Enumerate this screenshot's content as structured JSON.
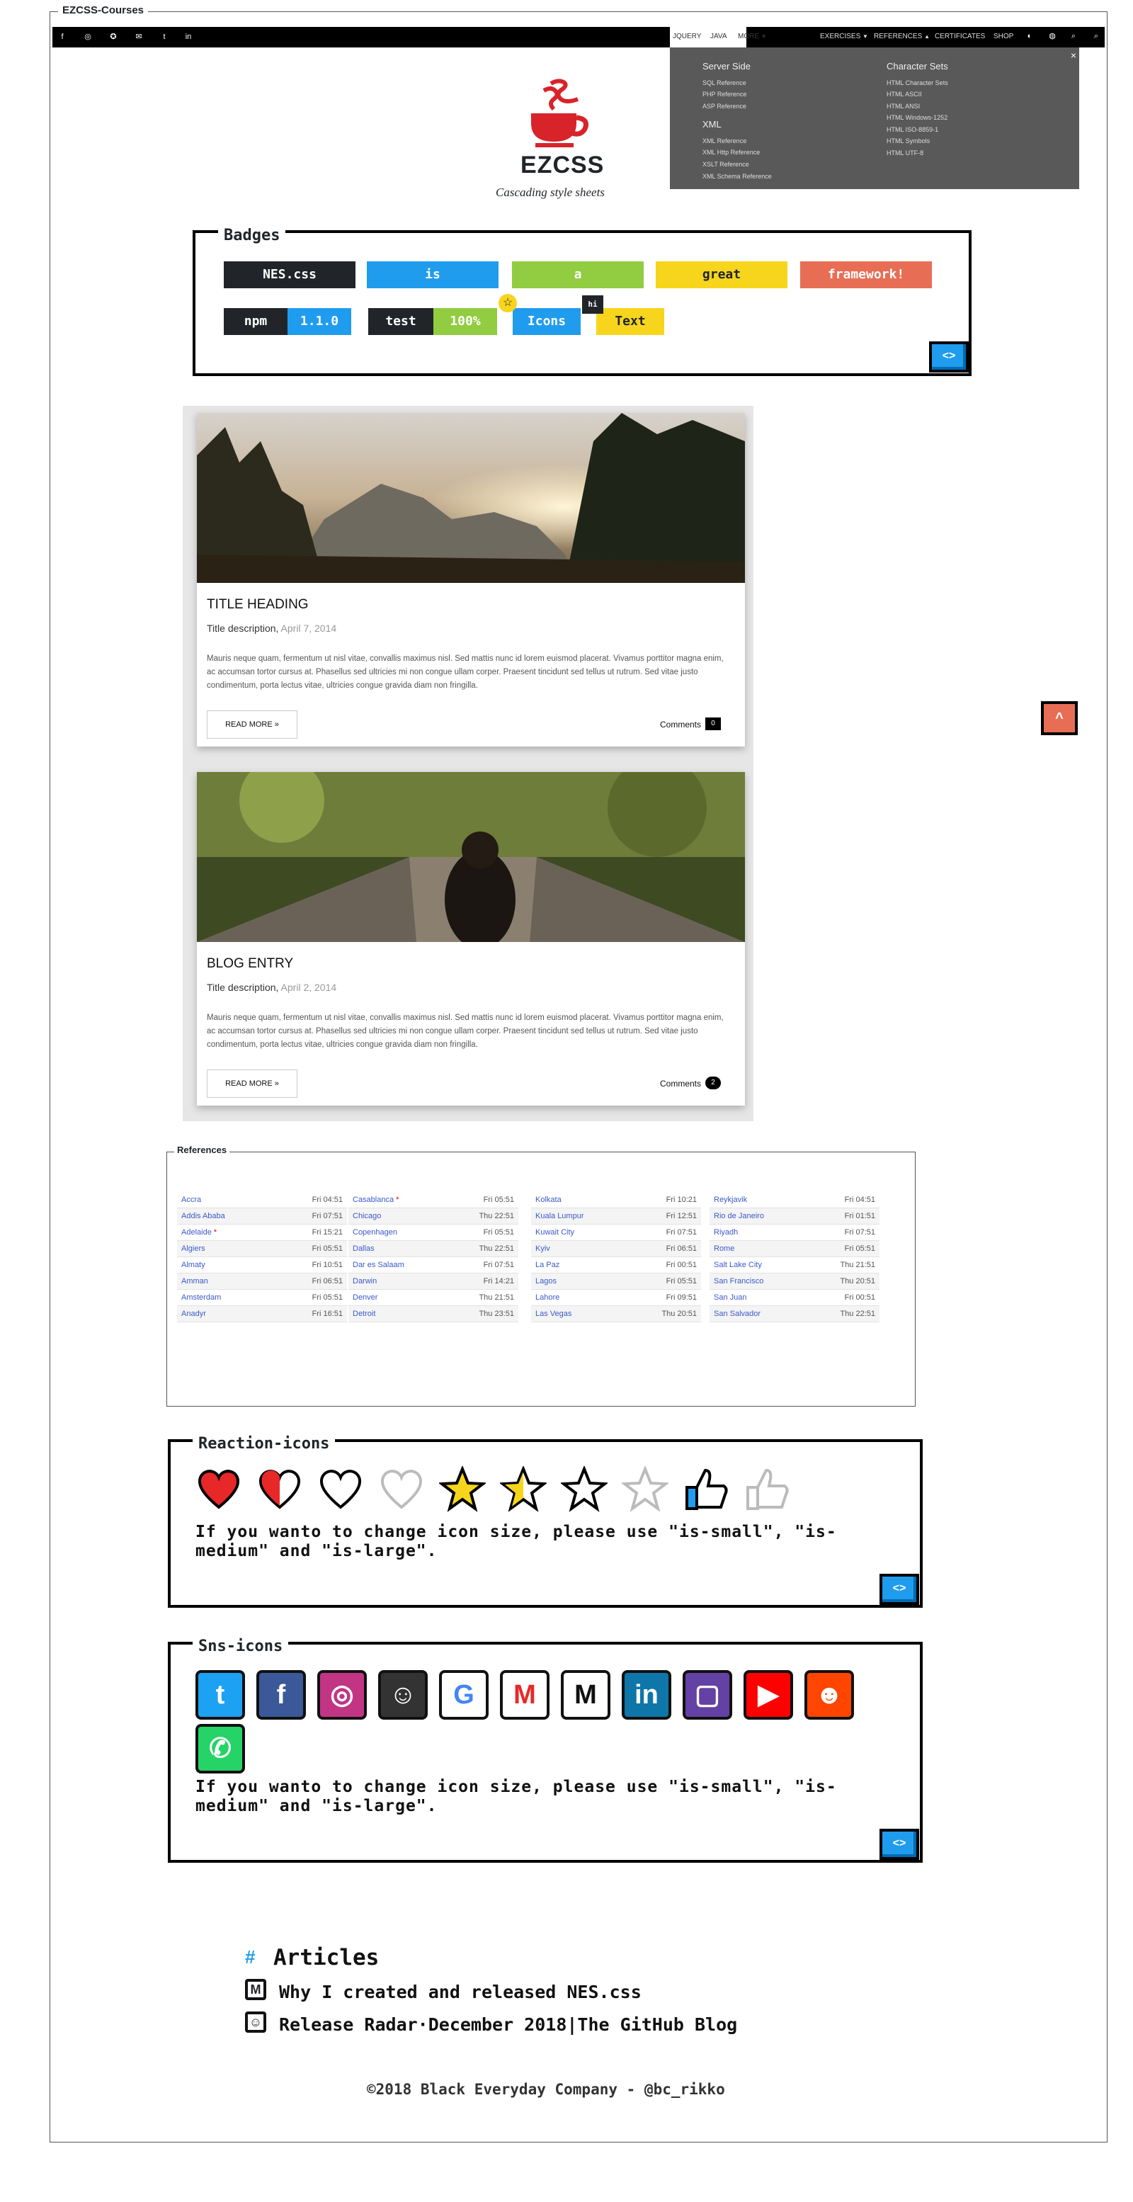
{
  "window": {
    "title": "EZCSS-Courses"
  },
  "topbar": {
    "social_icons": [
      "facebook-icon",
      "instagram-icon",
      "reddit-icon",
      "email-icon",
      "twitter-icon",
      "linkedin-icon"
    ],
    "nav_left": [
      "JQUERY",
      "JAVA",
      "MORE"
    ],
    "nav_right": [
      "EXERCISES",
      "REFERENCES",
      "CERTIFICATES",
      "SHOP"
    ],
    "right_icons": [
      "contrast-icon",
      "globe-icon",
      "search-icon",
      "search-icon"
    ]
  },
  "dropdown": {
    "close": "×",
    "col1": [
      {
        "heading": "Server Side",
        "items": [
          "SQL Reference",
          "PHP Reference",
          "ASP Reference"
        ]
      },
      {
        "heading": "XML",
        "items": [
          "XML Reference",
          "XML Http Reference",
          "XSLT Reference",
          "XML Schema Reference"
        ]
      }
    ],
    "col2": [
      {
        "heading": "Character Sets",
        "items": [
          "HTML Character Sets",
          "HTML ASCII",
          "HTML ANSI",
          "HTML Windows-1252",
          "HTML ISO-8859-1",
          "HTML Symbols",
          "HTML UTF-8"
        ]
      }
    ]
  },
  "logo": {
    "word": "EZCSS",
    "tagline": "Cascading style sheets"
  },
  "badges": {
    "title": "Badges",
    "row1": [
      "NES.css",
      "is",
      "a",
      "great",
      "framework!"
    ],
    "split": [
      {
        "left": "npm",
        "right": "1.1.0"
      },
      {
        "left": "test",
        "right": "100%"
      }
    ],
    "icon_badges": [
      {
        "label": "Icons",
        "icon": "star-icon"
      },
      {
        "label": "Text",
        "tag": "hi"
      }
    ],
    "code_button": "<>"
  },
  "colors": {
    "dark": "#212529",
    "blue": "#209cee",
    "green": "#92cc41",
    "yellow": "#f7d51d",
    "red": "#e76e55"
  },
  "cards": [
    {
      "title": "TITLE HEADING",
      "desc": "Title description,",
      "date": "April 7, 2014",
      "body": "Mauris neque quam, fermentum ut nisl vitae, convallis maximus nisl. Sed mattis nunc id lorem euismod placerat. Vivamus porttitor magna enim, ac accumsan tortor cursus at. Phasellus sed ultricies mi non congue ullam corper. Praesent tincidunt sed tellus ut rutrum. Sed vitae justo condimentum, porta lectus vitae, ultricies congue gravida diam non fringilla.",
      "button": "READ MORE »",
      "comments_label": "Comments",
      "comments_count": "0"
    },
    {
      "title": "BLOG ENTRY",
      "desc": "Title description,",
      "date": "April 2, 2014",
      "body": "Mauris neque quam, fermentum ut nisl vitae, convallis maximus nisl. Sed mattis nunc id lorem euismod placerat. Vivamus porttitor magna enim, ac accumsan tortor cursus at. Phasellus sed ultricies mi non congue ullam corper. Praesent tincidunt sed tellus ut rutrum. Sed vitae justo condimentum, porta lectus vitae, ultricies congue gravida diam non fringilla.",
      "button": "READ MORE »",
      "comments_label": "Comments",
      "comments_count": "2"
    }
  ],
  "scroll_top": "^",
  "references": {
    "legend": "References",
    "columns": [
      [
        [
          "Accra",
          "Fri 04:51"
        ],
        [
          "Addis Ababa",
          "Fri 07:51"
        ],
        [
          "Adelaide *",
          "Fri 15:21"
        ],
        [
          "Algiers",
          "Fri 05:51"
        ],
        [
          "Almaty",
          "Fri 10:51"
        ],
        [
          "Amman",
          "Fri 06:51"
        ],
        [
          "Amsterdam",
          "Fri 05:51"
        ],
        [
          "Anadyr",
          "Fri 16:51"
        ]
      ],
      [
        [
          "Casablanca *",
          "Fri 05:51"
        ],
        [
          "Chicago",
          "Thu 22:51"
        ],
        [
          "Copenhagen",
          "Fri 05:51"
        ],
        [
          "Dallas",
          "Thu 22:51"
        ],
        [
          "Dar es Salaam",
          "Fri 07:51"
        ],
        [
          "Darwin",
          "Fri 14:21"
        ],
        [
          "Denver",
          "Thu 21:51"
        ],
        [
          "Detroit",
          "Thu 23:51"
        ]
      ],
      [
        [
          "Kolkata",
          "Fri 10:21"
        ],
        [
          "Kuala Lumpur",
          "Fri 12:51"
        ],
        [
          "Kuwait City",
          "Fri 07:51"
        ],
        [
          "Kyiv",
          "Fri 06:51"
        ],
        [
          "La Paz",
          "Fri 00:51"
        ],
        [
          "Lagos",
          "Fri 05:51"
        ],
        [
          "Lahore",
          "Fri 09:51"
        ],
        [
          "Las Vegas",
          "Thu 20:51"
        ]
      ],
      [
        [
          "Reykjavik",
          "Fri 04:51"
        ],
        [
          "Rio de Janeiro",
          "Fri 01:51"
        ],
        [
          "Riyadh",
          "Fri 07:51"
        ],
        [
          "Rome",
          "Fri 05:51"
        ],
        [
          "Salt Lake City",
          "Thu 21:51"
        ],
        [
          "San Francisco",
          "Thu 20:51"
        ],
        [
          "San Juan",
          "Fri 00:51"
        ],
        [
          "San Salvador",
          "Thu 22:51"
        ]
      ]
    ]
  },
  "reactions": {
    "title": "Reaction-icons",
    "icons": [
      "heart-icon",
      "half-heart-icon",
      "empty-heart-icon",
      "transparent-heart-icon",
      "star-icon",
      "half-star-icon",
      "empty-star-icon",
      "transparent-star-icon",
      "like-icon",
      "empty-like-icon"
    ],
    "note": "If you wanto to change icon size, please use \"is-small\", \"is-medium\" and \"is-large\".",
    "code_button": "<>"
  },
  "sns": {
    "title": "Sns-icons",
    "icons": [
      {
        "name": "twitter-icon",
        "glyph": "t",
        "color": "#1da1f2"
      },
      {
        "name": "facebook-icon",
        "glyph": "f",
        "color": "#3b5998"
      },
      {
        "name": "instagram-icon",
        "glyph": "◎",
        "color": "#c13584"
      },
      {
        "name": "github-icon",
        "glyph": "☺",
        "color": "#333333"
      },
      {
        "name": "google-icon",
        "glyph": "G",
        "color": "#ffffff"
      },
      {
        "name": "gmail-icon",
        "glyph": "M",
        "color": "#ffffff"
      },
      {
        "name": "medium-icon",
        "glyph": "M",
        "color": "#ffffff"
      },
      {
        "name": "linkedin-icon",
        "glyph": "in",
        "color": "#0e76a8"
      },
      {
        "name": "twitch-icon",
        "glyph": "▢",
        "color": "#6441a5"
      },
      {
        "name": "youtube-icon",
        "glyph": "▶",
        "color": "#ff0000"
      },
      {
        "name": "reddit-icon",
        "glyph": "☻",
        "color": "#ff4500"
      },
      {
        "name": "whatsapp-icon",
        "glyph": "✆",
        "color": "#25d366"
      }
    ],
    "note": "If you wanto to change icon size, please use \"is-small\", \"is-medium\" and \"is-large\".",
    "code_button": "<>"
  },
  "articles": {
    "heading": "Articles",
    "items": [
      {
        "icon": "medium-icon",
        "text": "Why I created and released NES.css"
      },
      {
        "icon": "github-icon",
        "text": "Release Radar·December 2018|The GitHub Blog"
      }
    ]
  },
  "footer": {
    "text": "©2018 Black Everyday Company - @bc_rikko"
  }
}
